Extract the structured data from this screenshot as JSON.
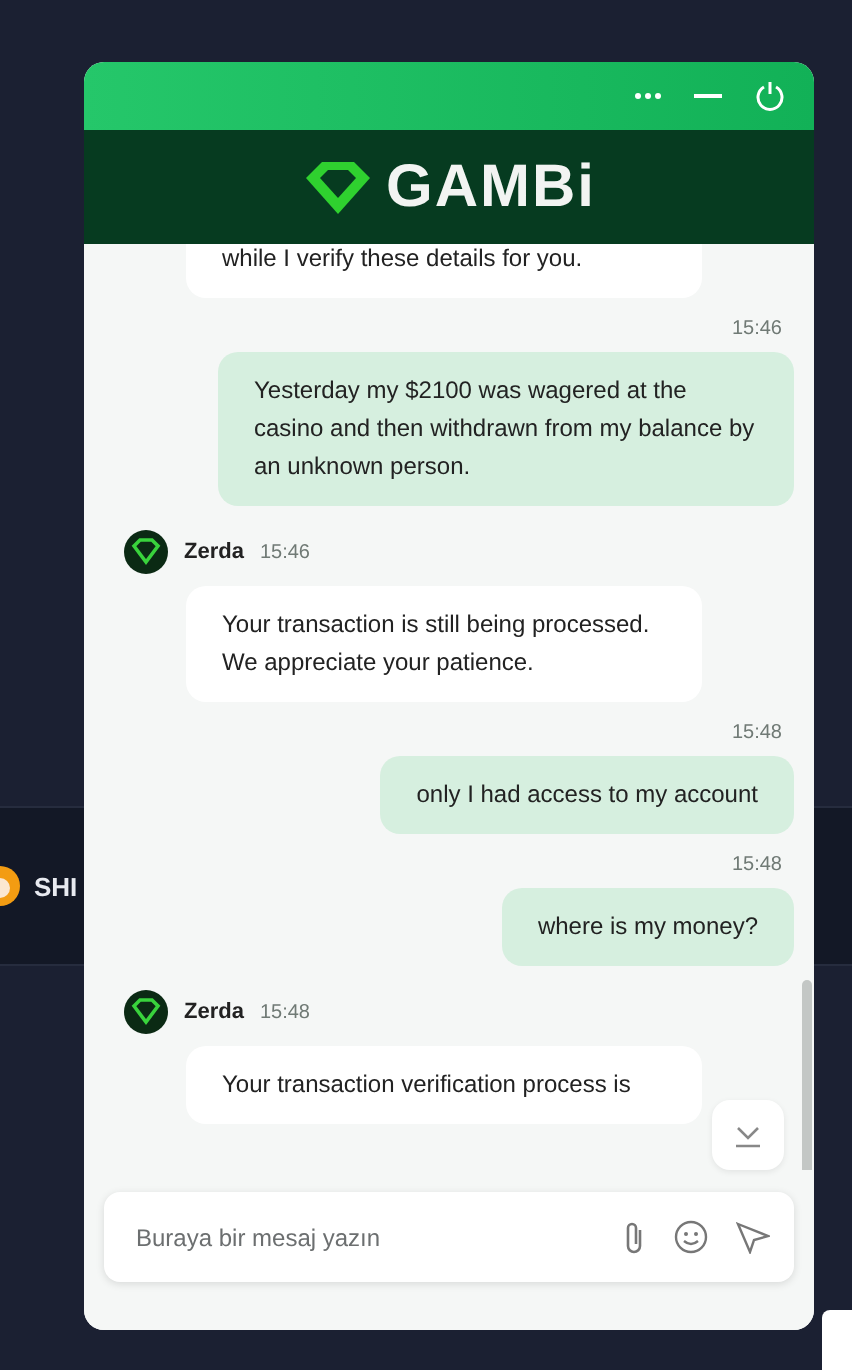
{
  "background": {
    "ticker": "SHI"
  },
  "chat": {
    "brand": "GAMBi",
    "messages": [
      {
        "kind": "agent",
        "text": "while I verify these details for you."
      },
      {
        "kind": "user",
        "time": "15:46",
        "text": "Yesterday my $2100 was wagered at the casino and then withdrawn from my balance by an unknown person."
      },
      {
        "kind": "agent",
        "sender": "Zerda",
        "time": "15:46",
        "text": "Your transaction is still being processed. We appreciate your patience."
      },
      {
        "kind": "user",
        "time": "15:48",
        "text": "only I had access to my account"
      },
      {
        "kind": "user",
        "time": "15:48",
        "text": "where is my money?"
      },
      {
        "kind": "agent",
        "sender": "Zerda",
        "time": "15:48",
        "text": "Your transaction verification process is"
      }
    ],
    "input": {
      "placeholder": "Buraya bir mesaj yazın"
    }
  }
}
